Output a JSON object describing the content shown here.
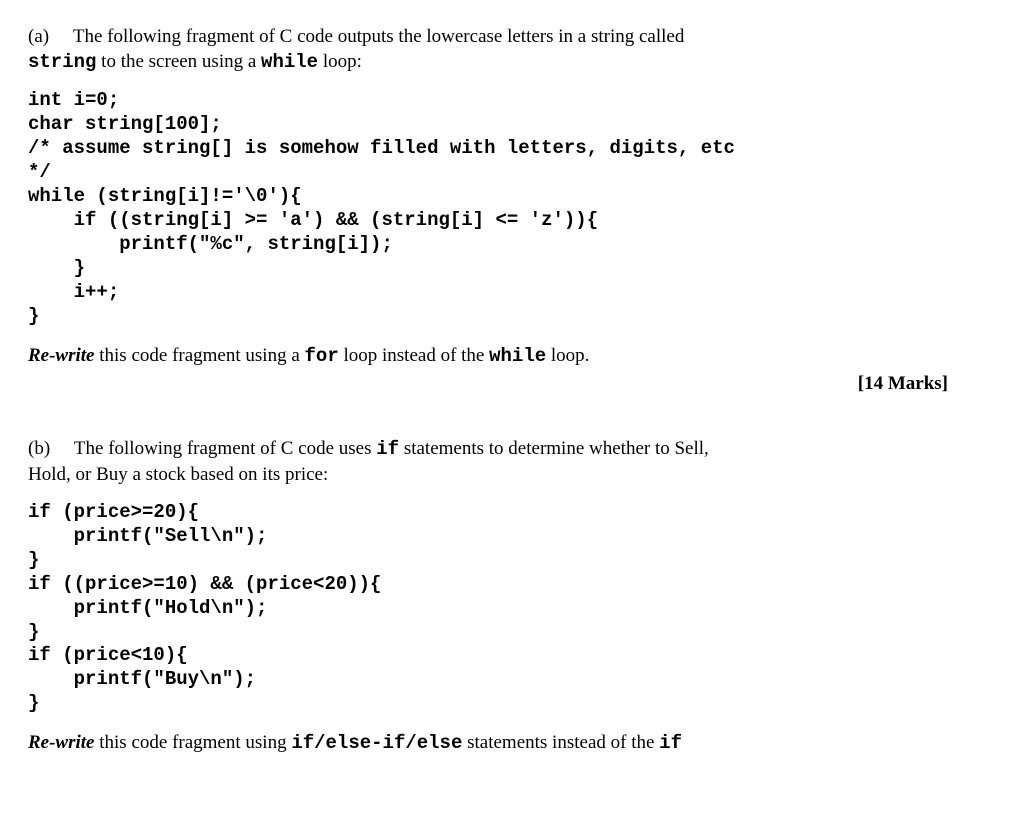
{
  "partA": {
    "label": "(a)",
    "intro1a": "The following fragment of C code outputs the lowercase letters in a string called",
    "intro1b": "string",
    "intro1c": " to the screen using a ",
    "intro1d": "while",
    "intro1e": " loop:",
    "code": "int i=0;\nchar string[100];\n/* assume string[] is somehow filled with letters, digits, etc\n*/\nwhile (string[i]!='\\0'){\n    if ((string[i] >= 'a') && (string[i] <= 'z')){\n        printf(\"%c\", string[i]);\n    }\n    i++;\n}",
    "rewritePrefix": "Re-write",
    "rewrite1": " this code fragment using a ",
    "rewriteCode1": "for",
    "rewrite2": " loop instead of the ",
    "rewriteCode2": "while",
    "rewrite3": " loop.",
    "marks": "[14 Marks]"
  },
  "partB": {
    "label": "(b)",
    "intro1a": "The following fragment of C code uses ",
    "intro1b": "if",
    "intro1c": " statements to determine whether to Sell,",
    "intro2": "Hold, or Buy a stock based on its price:",
    "code": "if (price>=20){\n    printf(\"Sell\\n\");\n}\nif ((price>=10) && (price<20)){\n    printf(\"Hold\\n\");\n}\nif (price<10){\n    printf(\"Buy\\n\");\n}",
    "rewritePrefix": "Re-write",
    "rewrite1": " this code fragment using ",
    "rewriteCode1": "if/else-if/else",
    "rewrite2": " statements instead of the ",
    "rewriteCode2": "if"
  }
}
